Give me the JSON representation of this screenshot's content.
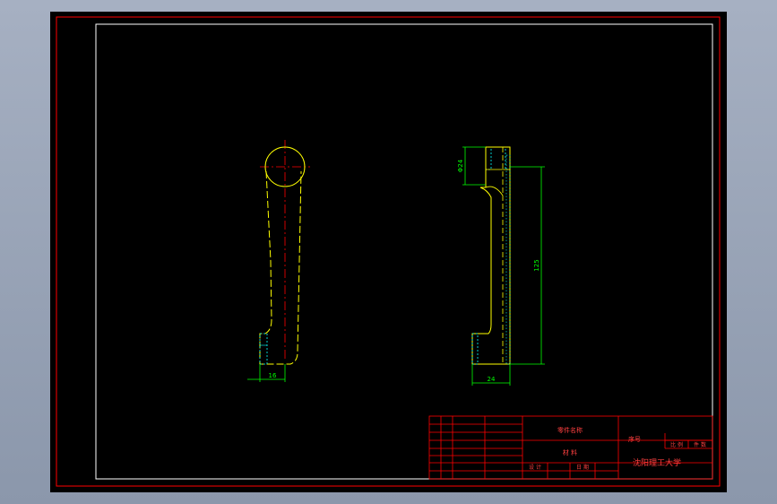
{
  "drawing": {
    "dimensions": {
      "front_width": "16",
      "side_width": "24",
      "side_height": "125",
      "side_top": "Φ24"
    },
    "title_block": {
      "part_name": "零件名称",
      "material": "材 料",
      "serial": "序号",
      "university": "沈阳理工大学",
      "scale_cell": "比 例",
      "count_cell": "件 数",
      "design_cell": "设 计",
      "date_cell": "日 期"
    }
  },
  "colors": {
    "paper": "#000000",
    "frame": "#ff0000",
    "inner_border": "#ffffff",
    "outline": "#ffff00",
    "dimension": "#00ff00",
    "centerline": "#ff0000",
    "hatch": "#00ffff",
    "title_text": "#ff4040"
  }
}
